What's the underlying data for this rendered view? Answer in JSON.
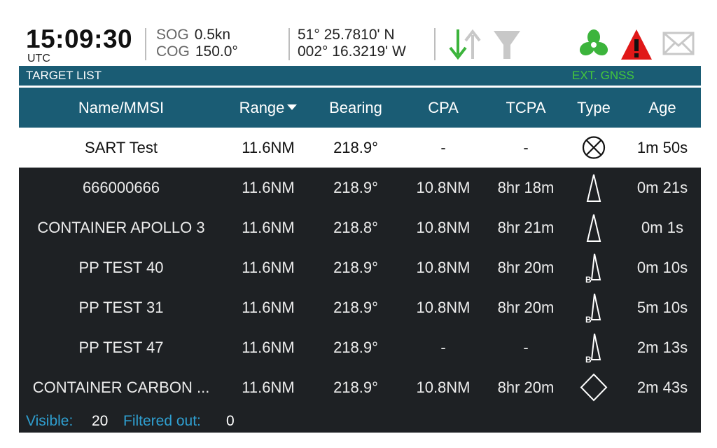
{
  "status": {
    "time": "15:09:30",
    "time_zone": "UTC",
    "sog_label": "SOG",
    "sog_value": "0.5kn",
    "cog_label": "COG",
    "cog_value": "150.0°",
    "latitude": "51° 25.7810' N",
    "longitude": "002° 16.3219' W",
    "icons": [
      "transfer-arrows-icon",
      "antenna-icon",
      "fan-icon",
      "warning-icon",
      "envelope-icon"
    ],
    "colors": {
      "arrow_active": "#3cb43c",
      "icon_inactive": "#c8c8c8",
      "fan": "#3cb43c",
      "warning": "#e01818"
    }
  },
  "title_bar": {
    "title": "TARGET LIST",
    "source": "EXT. GNSS",
    "colors": {
      "background": "#1a5c74",
      "source": "#44c83c"
    }
  },
  "table": {
    "columns": [
      "Name/MMSI",
      "Range",
      "Bearing",
      "CPA",
      "TCPA",
      "Type",
      "Age"
    ],
    "sort_column": "Range",
    "sort_direction": "descending",
    "rows": [
      {
        "name": "SART Test",
        "range": "11.6NM",
        "bearing": "218.9°",
        "cpa": "-",
        "tcpa": "-",
        "type": "sart-icon",
        "age": "1m 50s",
        "selected": true
      },
      {
        "name": "666000666",
        "range": "11.6NM",
        "bearing": "218.9°",
        "cpa": "10.8NM",
        "tcpa": "8hr 18m",
        "type": "class-a-vessel-icon",
        "age": "0m 21s"
      },
      {
        "name": "CONTAINER APOLLO 3",
        "range": "11.6NM",
        "bearing": "218.8°",
        "cpa": "10.8NM",
        "tcpa": "8hr 21m",
        "type": "class-a-vessel-icon",
        "age": "0m 1s"
      },
      {
        "name": "PP TEST 40",
        "range": "11.6NM",
        "bearing": "218.9°",
        "cpa": "10.8NM",
        "tcpa": "8hr 20m",
        "type": "class-b-vessel-icon",
        "age": "0m 10s"
      },
      {
        "name": "PP TEST 31",
        "range": "11.6NM",
        "bearing": "218.9°",
        "cpa": "10.8NM",
        "tcpa": "8hr 20m",
        "type": "class-b-vessel-icon",
        "age": "5m 10s"
      },
      {
        "name": "PP TEST 47",
        "range": "11.6NM",
        "bearing": "218.9°",
        "cpa": "-",
        "tcpa": "-",
        "type": "class-b-vessel-icon",
        "age": "2m 13s"
      },
      {
        "name": "CONTAINER CARBON ...",
        "range": "11.6NM",
        "bearing": "218.9°",
        "cpa": "10.8NM",
        "tcpa": "8hr 20m",
        "type": "base-station-icon",
        "age": "2m 43s"
      }
    ]
  },
  "footer": {
    "visible_label": "Visible:",
    "visible_value": "20",
    "filtered_label": "Filtered out:",
    "filtered_value": "0"
  }
}
